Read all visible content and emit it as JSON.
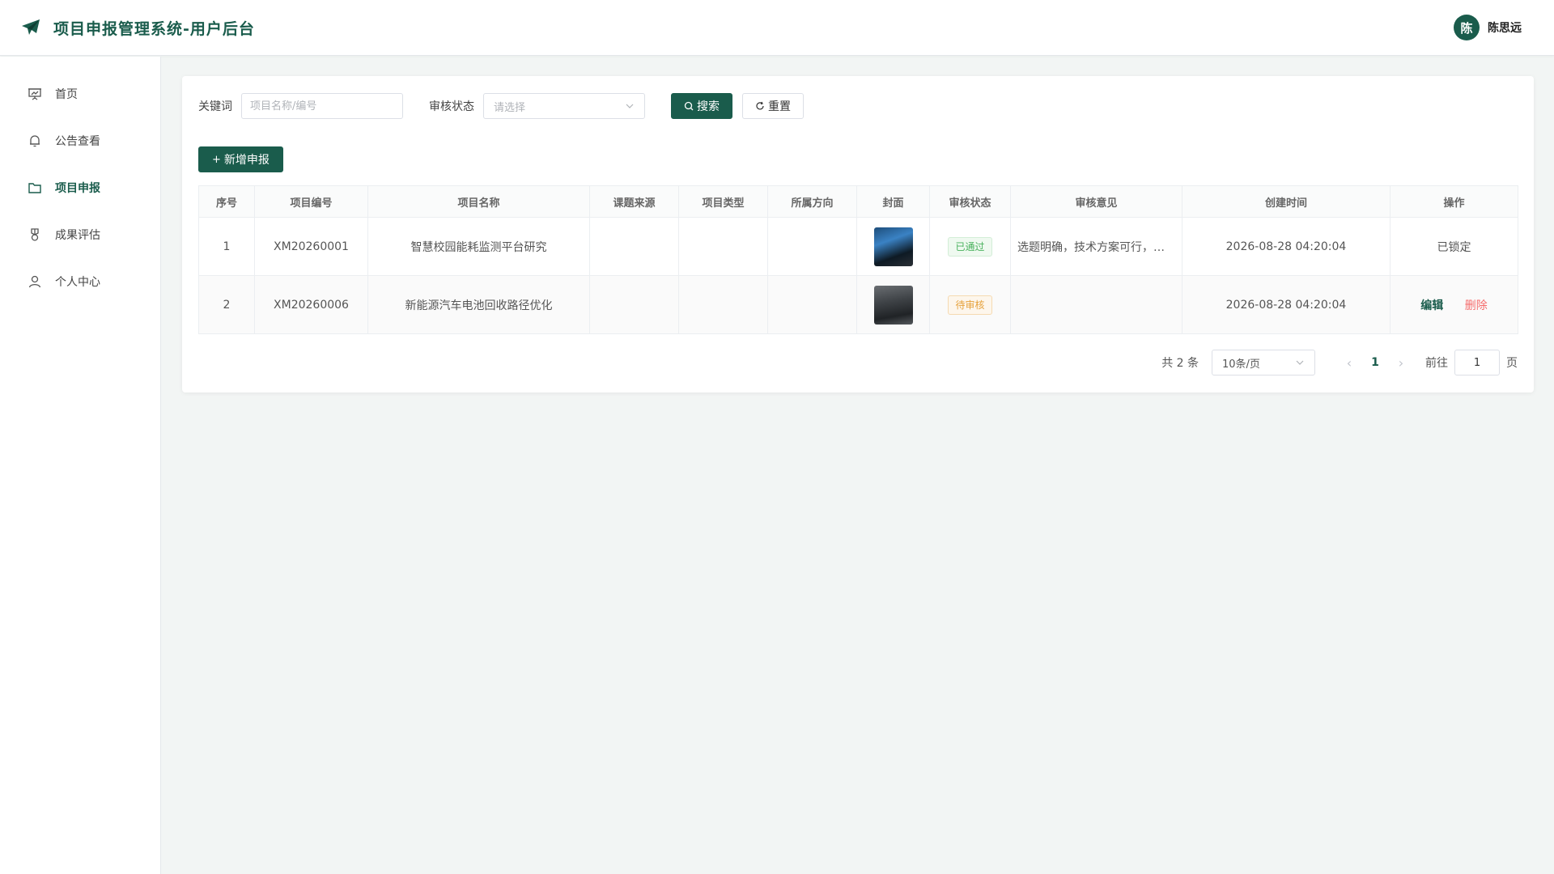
{
  "header": {
    "title": "项目申报管理系统-用户后台",
    "user_avatar_text": "陈",
    "user_name": "陈思远"
  },
  "sidebar": {
    "items": [
      {
        "label": "首页",
        "icon": "presentation-chart-icon"
      },
      {
        "label": "公告查看",
        "icon": "bell-icon"
      },
      {
        "label": "项目申报",
        "icon": "folder-icon",
        "active": true
      },
      {
        "label": "成果评估",
        "icon": "medal-icon"
      },
      {
        "label": "个人中心",
        "icon": "user-icon"
      }
    ]
  },
  "filters": {
    "keyword_label": "关键词",
    "keyword_placeholder": "项目名称/编号",
    "keyword_value": "",
    "status_label": "审核状态",
    "status_placeholder": "请选择",
    "search_label": "搜索",
    "reset_label": "重置"
  },
  "actions": {
    "add_label": "新增申报"
  },
  "table": {
    "columns": [
      "序号",
      "项目编号",
      "项目名称",
      "课题来源",
      "项目类型",
      "所属方向",
      "封面",
      "审核状态",
      "审核意见",
      "创建时间",
      "操作"
    ],
    "rows": [
      {
        "index": "1",
        "code": "XM20260001",
        "name": "智慧校园能耗监测平台研究",
        "source": "",
        "type": "",
        "direction": "",
        "status": "已通过",
        "opinion": "选题明确，技术方案可行，建议推进实施",
        "created": "2026-08-28 04:20:04",
        "op_text": "已锁定"
      },
      {
        "index": "2",
        "code": "XM20260006",
        "name": "新能源汽车电池回收路径优化",
        "source": "",
        "type": "",
        "direction": "",
        "status": "待审核",
        "opinion": "",
        "created": "2026-08-28 04:20:04",
        "edit_label": "编辑",
        "delete_label": "删除"
      }
    ]
  },
  "pagination": {
    "total_text": "共 2 条",
    "page_size": "10条/页",
    "current_page": "1",
    "goto_label": "前往",
    "goto_value": "1",
    "page_suffix": "页"
  },
  "colors": {
    "primary": "#1a5c4c",
    "success": "#48b15c",
    "warning": "#e6a23c",
    "danger": "#f56c6c"
  }
}
